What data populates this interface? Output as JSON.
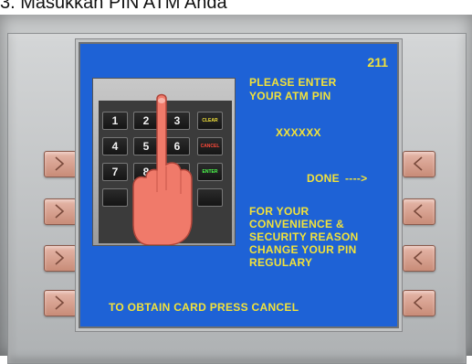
{
  "caption": "3. Masukkan PIN ATM Anda",
  "screen": {
    "number": "211",
    "line1": "PLEASE  ENTER",
    "line2": "YOUR  ATM  PIN",
    "pin_mask": "XXXXXX",
    "done_label": "DONE",
    "done_arrow": "---->",
    "notice": [
      "FOR  YOUR",
      "CONVENIENCE  &",
      "SECURITY  REASON",
      "CHANGE  YOUR  PIN",
      "REGULARY"
    ],
    "footer": "TO  OBTAIN  CARD  PRESS  CANCEL"
  },
  "keypad": {
    "keys": [
      "1",
      "2",
      "3",
      "4",
      "5",
      "6",
      "7",
      "8",
      "9"
    ],
    "clear": "CLEAR",
    "cancel": "CANCEL",
    "enter": "ENTER"
  },
  "colors": {
    "screen": "#1e62d6",
    "text": "#f2e23a",
    "side_button": "#d9a08c"
  }
}
